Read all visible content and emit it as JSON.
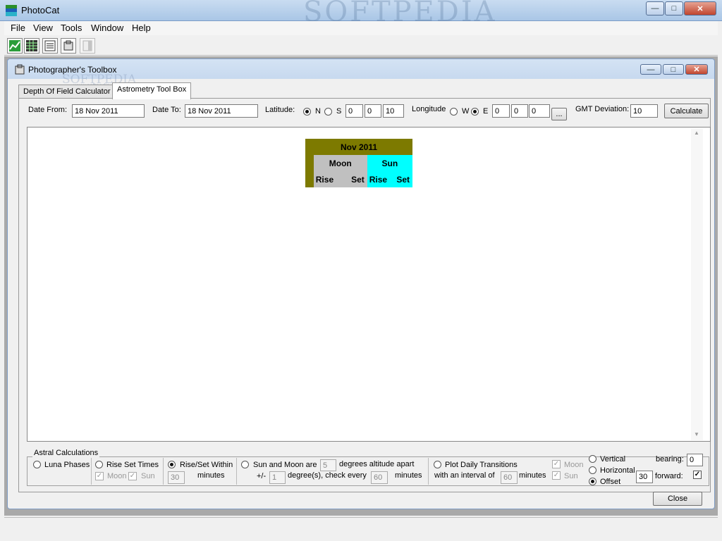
{
  "app": {
    "title": "PhotoCat",
    "watermark": "SOFTPEDIA"
  },
  "window_controls": {
    "minimize": "—",
    "maximize": "□",
    "close": "✕"
  },
  "menu": [
    "File",
    "View",
    "Tools",
    "Window",
    "Help"
  ],
  "toolbar_icons": [
    "chart-icon",
    "grid-icon",
    "list-icon",
    "toolbox-icon",
    "document-icon"
  ],
  "child": {
    "title": "Photographer's Toolbox",
    "watermark": "SOFTPEDIA",
    "watermark_url": "www.softpedia.com"
  },
  "tabs": [
    {
      "label": "Depth Of Field Calculator",
      "active": false
    },
    {
      "label": "Astrometry Tool Box",
      "active": true
    }
  ],
  "inputs": {
    "date_from_label": "Date From:",
    "date_from": "18 Nov 2011",
    "date_to_label": "Date To:",
    "date_to": "18 Nov 2011",
    "latitude_label": "Latitude:",
    "lat_n": "N",
    "lat_s": "S",
    "lat_deg": "0",
    "lat_min": "0",
    "lat_sec": "10",
    "longitude_label": "Longitude",
    "lon_w": "W",
    "lon_e": "E",
    "lon_deg": "0",
    "lon_min": "0",
    "lon_sec": "0",
    "browse": "...",
    "gmt_label": "GMT Deviation:",
    "gmt": "10",
    "calculate": "Calculate"
  },
  "result": {
    "month": "Nov 2011",
    "moon": "Moon",
    "sun": "Sun",
    "rise": "Rise",
    "set": "Set",
    "colors": {
      "header": "#7d7a00",
      "moon": "#c0c0c0",
      "sun": "#00ffff"
    }
  },
  "astral": {
    "title": "Astral Calculations",
    "luna": "Luna Phases",
    "riseset": "Rise Set Times",
    "moon": "Moon",
    "sun": "Sun",
    "within": "Rise/Set Within",
    "within_value": "30",
    "minutes": "minutes",
    "sunmoon": "Sun and Moon are",
    "sunmoon_value": "5",
    "degrees_apart": "degrees altitude apart",
    "plusminus": "+/-",
    "pm_value": "1",
    "degree_check": "degree(s), check every",
    "check_value": "60",
    "plot": "Plot Daily Transitions",
    "interval": "with an interval of",
    "interval_value": "60",
    "vertical": "Vertical",
    "horizontal": "Horizontal",
    "offset": "Offset",
    "offset_value": "30",
    "bearing": "bearing:",
    "bearing_value": "0",
    "forward": "forward:"
  },
  "close": "Close"
}
